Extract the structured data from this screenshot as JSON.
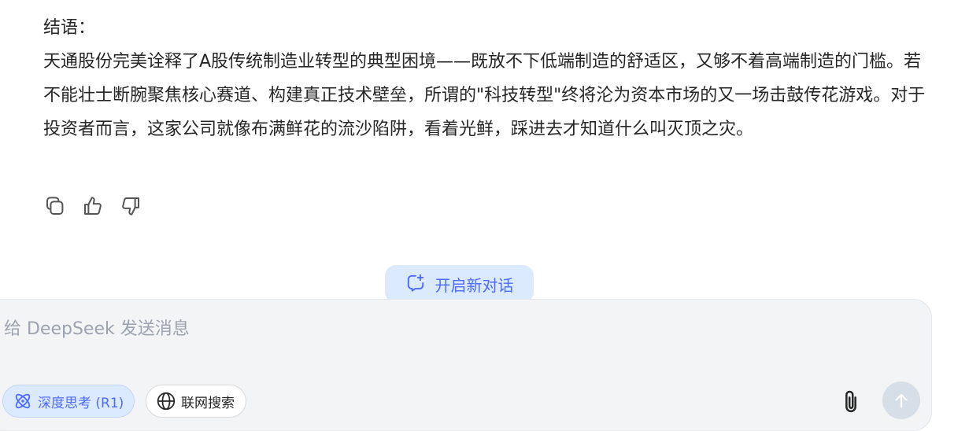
{
  "message": {
    "heading": "结语：",
    "body": "天通股份完美诠释了A股传统制造业转型的典型困境——既放不下低端制造的舒适区，又够不着高端制造的门槛。若不能壮士断腕聚焦核心赛道、构建真正技术壁垒，所谓的\"科技转型\"终将沦为资本市场的又一场击鼓传花游戏。对于投资者而言，这家公司就像布满鲜花的流沙陷阱，看着光鲜，踩进去才知道什么叫灭顶之灾。"
  },
  "actions": {
    "icons": [
      "copy-icon",
      "thumbs-up-icon",
      "thumbs-down-icon"
    ]
  },
  "new_chat": {
    "label": "开启新对话",
    "icon": "new-chat-icon"
  },
  "composer": {
    "placeholder": "给 DeepSeek 发送消息",
    "value": "",
    "deep_think_label": "深度思考 (R1)",
    "web_search_label": "联网搜索",
    "icons": [
      "atom-icon",
      "globe-icon",
      "paperclip-icon",
      "arrow-up-icon"
    ]
  },
  "colors": {
    "accent": "#4d6bfe",
    "accent_bg": "#dbeafe",
    "text": "#262626",
    "composer_bg": "#f3f4f6",
    "send_disabled": "#d6dee8"
  }
}
